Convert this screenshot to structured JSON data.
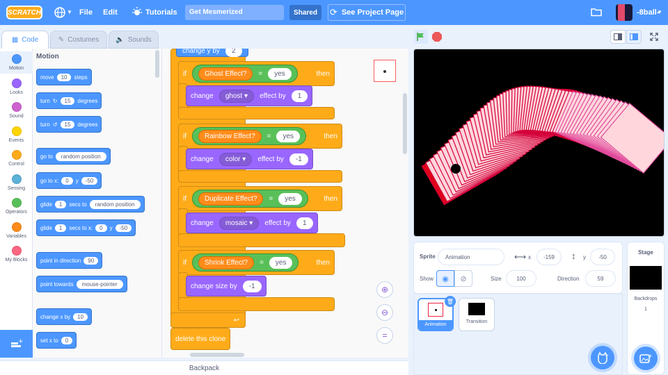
{
  "menubar": {
    "logo": "SCRATCH",
    "file": "File",
    "edit": "Edit",
    "tutorials": "Tutorials",
    "project_title": "Get Mesmerized",
    "shared": "Shared",
    "see_project": "See Project Page",
    "username": "-8ball-"
  },
  "tabs": {
    "code": "Code",
    "costumes": "Costumes",
    "sounds": "Sounds"
  },
  "categories": [
    "Motion",
    "Looks",
    "Sound",
    "Events",
    "Control",
    "Sensing",
    "Operators",
    "Variables",
    "My Blocks"
  ],
  "category_colors": [
    "#4c97ff",
    "#9966ff",
    "#cf63cf",
    "#ffd500",
    "#ffab19",
    "#5cb1d6",
    "#59c059",
    "#ff8c1a",
    "#ff6680"
  ],
  "palette": {
    "heading": "Motion",
    "move": "move",
    "move_steps": "10",
    "steps": "steps",
    "turn": "turn",
    "turn_deg": "15",
    "degrees": "degrees",
    "go_to": "go to",
    "random_position": "random position",
    "go_to_x": "go to x:",
    "x_val": "0",
    "y": "y",
    "y_val": "-50",
    "glide": "glide",
    "glide_secs": "1",
    "secs_to": "secs to",
    "secs_to_x": "secs to x:",
    "point_dir": "point in direction",
    "dir_val": "90",
    "point_towards": "point towards",
    "mouse_pointer": "mouse-pointer",
    "change_x": "change x by",
    "change_x_val": "10",
    "set_x": "set x to",
    "set_x_val": "0"
  },
  "script": {
    "top_partial": "change y by",
    "top_partial_val": "2",
    "if": "if",
    "then": "then",
    "eq": "=",
    "yes": "yes",
    "change": "change",
    "effect_by": "effect by",
    "ghost_var": "Ghost Effect?",
    "ghost": "ghost",
    "ghost_val": "1",
    "rainbow_var": "Rainbow Effect?",
    "color": "color",
    "color_val": "-1",
    "dup_var": "Duplicate Effect?",
    "mosaic": "mosaic",
    "mosaic_val": "1",
    "shrink_var": "Shrink Effect?",
    "change_size": "change size by",
    "size_val": "-1",
    "delete_clone": "delete this clone"
  },
  "sprite_info": {
    "sprite_label": "Sprite",
    "sprite_name": "Animation",
    "x_label": "x",
    "x": "-159",
    "y_label": "y",
    "y": "-50",
    "show_label": "Show",
    "size_label": "Size",
    "size": "100",
    "direction_label": "Direction",
    "direction": "59"
  },
  "sprites": [
    {
      "name": "Animation"
    },
    {
      "name": "Transition"
    }
  ],
  "stage_panel": {
    "title": "Stage",
    "backdrops_label": "Backdrops",
    "backdrops_count": "1"
  },
  "backpack": "Backpack",
  "colors": {
    "accent": "#4c97ff",
    "control": "#ffab19",
    "looks": "#9966ff",
    "operators": "#59c059",
    "variables": "#ff8c1a",
    "stage_bg": "#000000"
  }
}
